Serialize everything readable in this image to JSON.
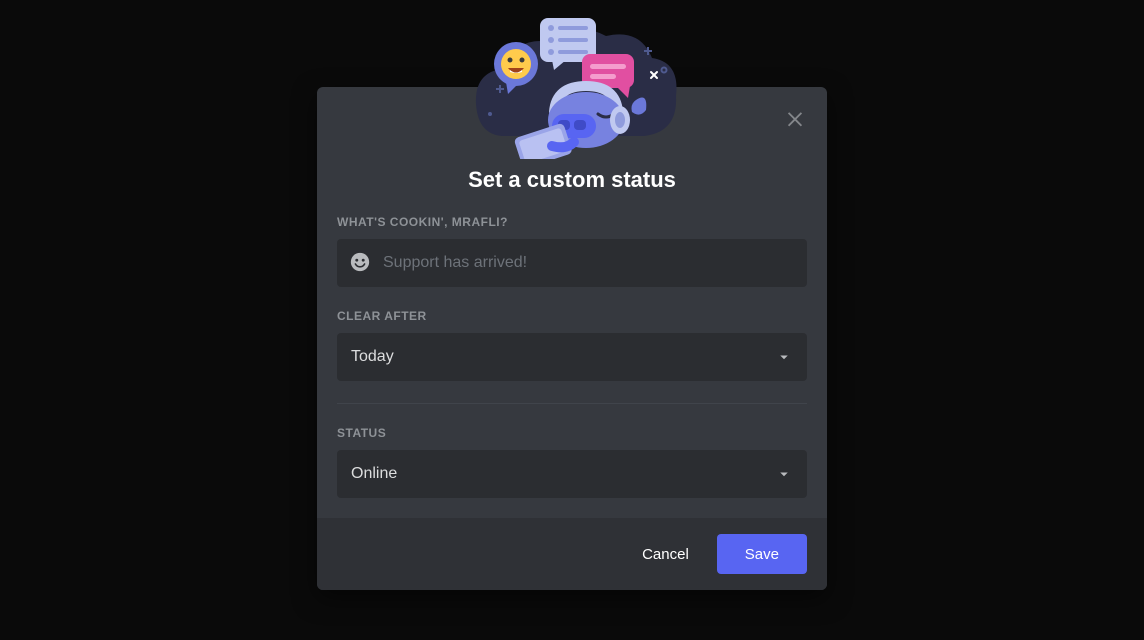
{
  "modal": {
    "title": "Set a custom status",
    "close_icon": "close-icon"
  },
  "status_field": {
    "label": "WHAT'S COOKIN', MRAFLI?",
    "placeholder": "Support has arrived!",
    "value": "",
    "emoji_icon": "smile-icon"
  },
  "clear_after": {
    "label": "CLEAR AFTER",
    "selected": "Today"
  },
  "status_select": {
    "label": "STATUS",
    "selected": "Online"
  },
  "footer": {
    "cancel": "Cancel",
    "save": "Save"
  },
  "colors": {
    "accent": "#5865f2",
    "modal_bg": "#36393f",
    "footer_bg": "#2f3136",
    "input_bg": "#2b2d31"
  }
}
